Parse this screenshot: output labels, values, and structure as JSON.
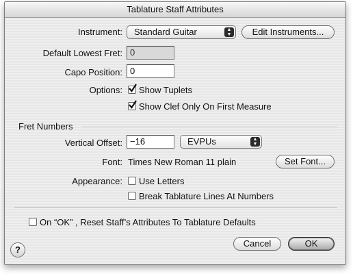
{
  "window": {
    "title": "Tablature Staff Attributes"
  },
  "instrument": {
    "label": "Instrument:",
    "value": "Standard Guitar",
    "edit_button": "Edit Instruments..."
  },
  "lowest_fret": {
    "label": "Default Lowest Fret:",
    "value": "0",
    "enabled": false
  },
  "capo": {
    "label": "Capo Position:",
    "value": "0"
  },
  "options": {
    "label": "Options:",
    "show_tuplets": {
      "label": "Show Tuplets",
      "checked": true
    },
    "show_clef": {
      "label": "Show Clef Only On First Measure",
      "checked": true
    }
  },
  "fret_numbers": {
    "group_label": "Fret Numbers",
    "vertical_offset": {
      "label": "Vertical Offset:",
      "value": "−16",
      "unit": "EVPUs"
    },
    "font": {
      "label": "Font:",
      "value": "Times New Roman 11 plain",
      "button": "Set Font..."
    },
    "appearance": {
      "label": "Appearance:",
      "use_letters": {
        "label": "Use Letters",
        "checked": false
      },
      "break_lines": {
        "label": "Break Tablature Lines At Numbers",
        "checked": false
      }
    }
  },
  "reset": {
    "label": "On “OK” , Reset Staff’s Attributes To Tablature Defaults",
    "checked": false
  },
  "buttons": {
    "help": "?",
    "cancel": "Cancel",
    "ok": "OK"
  },
  "colors": {
    "accent": "#2a2a2a",
    "background": "#ececec"
  }
}
